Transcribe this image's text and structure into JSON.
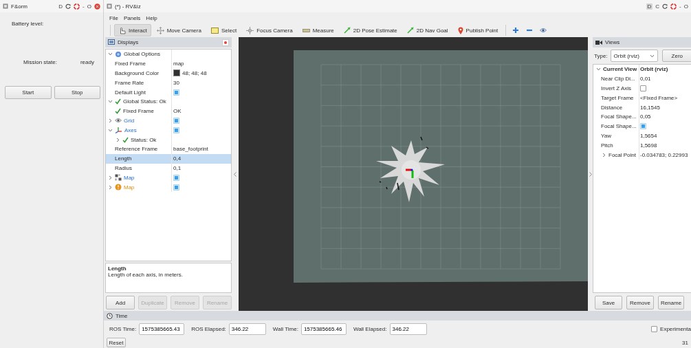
{
  "form_window": {
    "title": "F&orm",
    "title_buttons": [
      {
        "kind": "text",
        "label": "D"
      },
      {
        "kind": "refresh"
      },
      {
        "kind": "lifebuoy"
      },
      {
        "kind": "text",
        "label": "-"
      },
      {
        "kind": "text",
        "label": "O"
      },
      {
        "kind": "close"
      }
    ],
    "battery_label": "Battery level:",
    "mission_label": "Mission state:",
    "mission_value": "ready",
    "buttons": [
      "Start",
      "Stop"
    ]
  },
  "rviz_window": {
    "title": "(*) - RV&iz",
    "title_buttons": [
      {
        "kind": "boxed",
        "label": "D"
      },
      {
        "kind": "text",
        "label": "C"
      },
      {
        "kind": "refresh"
      },
      {
        "kind": "lifebuoy"
      },
      {
        "kind": "text",
        "label": "-"
      },
      {
        "kind": "text",
        "label": "O"
      }
    ]
  },
  "menu": [
    "File",
    "Panels",
    "Help"
  ],
  "tools": [
    {
      "kind": "interact",
      "label": "Interact",
      "selected": true
    },
    {
      "kind": "move",
      "label": "Move Camera",
      "selected": false
    },
    {
      "kind": "select",
      "label": "Select",
      "selected": false
    },
    {
      "kind": "focus",
      "label": "Focus Camera",
      "selected": false
    },
    {
      "kind": "measure",
      "label": "Measure",
      "selected": false
    },
    {
      "kind": "pose",
      "label": "2D Pose Estimate",
      "selected": false
    },
    {
      "kind": "goal",
      "label": "2D Nav Goal",
      "selected": false
    },
    {
      "kind": "point",
      "label": "Publish Point",
      "selected": false
    },
    {
      "kind": "add",
      "selected": false
    },
    {
      "kind": "remove",
      "selected": false
    },
    {
      "kind": "eye",
      "selected": false
    }
  ],
  "displays": {
    "title": "Displays",
    "tree": [
      {
        "kind": "options",
        "name": "Global Options",
        "expanded": true,
        "selected": false,
        "children": [
          {
            "name": "Fixed Frame",
            "value": "map",
            "selected": false
          },
          {
            "name": "Background Color",
            "value": "48; 48; 48",
            "color": "#303030",
            "selected": false
          },
          {
            "name": "Frame Rate",
            "value": "30",
            "selected": false
          },
          {
            "name": "Default Light",
            "checked": true,
            "selected": false
          }
        ]
      },
      {
        "kind": "status",
        "name": "Global Status: Ok",
        "expanded": true,
        "selected": false,
        "children": [
          {
            "kind": "status",
            "name": "Fixed Frame",
            "value": "OK",
            "selected": false
          }
        ]
      },
      {
        "kind": "grid",
        "name": "Grid",
        "expanded": false,
        "checked": true,
        "warning": false,
        "selected": false
      },
      {
        "kind": "axes",
        "name": "Axes",
        "expanded": true,
        "checked": true,
        "warning": false,
        "selected": false,
        "children": [
          {
            "kind": "status",
            "name": "Status: Ok",
            "expanded": false,
            "selected": false
          },
          {
            "name": "Reference Frame",
            "value": "base_footprint",
            "selected": false
          },
          {
            "name": "Length",
            "value": "0,4",
            "selected": true
          },
          {
            "name": "Radius",
            "value": "0,1",
            "selected": false
          }
        ]
      },
      {
        "kind": "map",
        "name": "Map",
        "expanded": false,
        "checked": true,
        "warning": false,
        "selected": false
      },
      {
        "kind": "costmap",
        "name": "Map",
        "expanded": false,
        "checked": true,
        "warning": true,
        "selected": false
      }
    ],
    "description": {
      "title": "Length",
      "text": "Length of each axis, in meters."
    },
    "buttons": [
      {
        "label": "Add",
        "disabled": false
      },
      {
        "label": "Duplicate",
        "disabled": true
      },
      {
        "label": "Remove",
        "disabled": true
      },
      {
        "label": "Rename",
        "disabled": true
      }
    ]
  },
  "views": {
    "title": "Views",
    "type_label": "Type:",
    "type_value": "Orbit (rviz)",
    "zero_button": "Zero",
    "tree": [
      {
        "kind": "group",
        "name": "Current View",
        "value": "Orbit (rviz)",
        "expanded": true,
        "selected": false,
        "children": [
          {
            "name": "Near Clip Di...",
            "value": "0,01",
            "selected": false
          },
          {
            "name": "Invert Z Axis",
            "checked": false,
            "selected": false
          },
          {
            "name": "Target Frame",
            "value": "<Fixed Frame>",
            "selected": false
          },
          {
            "name": "Distance",
            "value": "16,1545",
            "selected": false
          },
          {
            "name": "Focal Shape...",
            "value": "0,05",
            "selected": false
          },
          {
            "name": "Focal Shape...",
            "checked": true,
            "selected": false
          },
          {
            "name": "Yaw",
            "value": "1,5654",
            "selected": false
          },
          {
            "name": "Pitch",
            "value": "1,5698",
            "selected": false
          },
          {
            "name": "Focal Point",
            "value": "-0.034783; 0.22993",
            "expanded": false,
            "selected": false
          }
        ]
      }
    ],
    "buttons": [
      "Save",
      "Remove",
      "Rename"
    ]
  },
  "time": {
    "title": "Time",
    "fields": [
      {
        "label": "ROS Time:",
        "value": "1575385665.43"
      },
      {
        "label": "ROS Elapsed:",
        "value": "346.22"
      },
      {
        "label": "Wall Time:",
        "value": "1575385665.46"
      },
      {
        "label": "Wall Elapsed:",
        "value": "346.22"
      }
    ],
    "experimental": {
      "label": "Experimenta",
      "checked": false
    }
  },
  "status_bar": {
    "reset_button": "Reset",
    "fps": "31"
  }
}
